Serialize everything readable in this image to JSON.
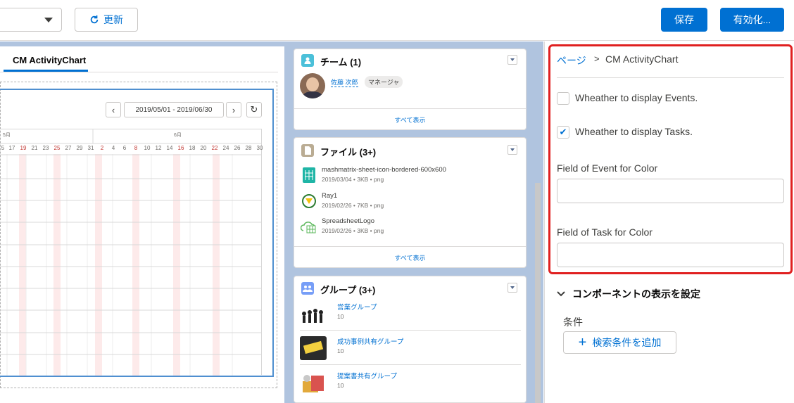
{
  "toolbar": {
    "refresh_label": "更新",
    "save_label": "保存",
    "activate_label": "有効化..."
  },
  "tabs": [
    {
      "label": "CM ActivityChart"
    }
  ],
  "activity_chart": {
    "date_range": "2019/05/01 - 2019/06/30",
    "prev_label": "‹",
    "next_label": "›",
    "refresh_label": "↻",
    "months": [
      "5月",
      "6月"
    ],
    "days": [
      "5",
      "17",
      "19",
      "21",
      "23",
      "25",
      "27",
      "29",
      "31",
      "2",
      "4",
      "6",
      "8",
      "10",
      "12",
      "14",
      "16",
      "18",
      "20",
      "22",
      "24",
      "26",
      "28",
      "30"
    ],
    "weekend_days": [
      "19",
      "25",
      "2",
      "8",
      "16",
      "22"
    ]
  },
  "team_card": {
    "title": "チーム (1)",
    "member_name": "佐藤 次郎",
    "member_role": "マネージャ",
    "view_all": "すべて表示"
  },
  "files_card": {
    "title": "ファイル (3+)",
    "files": [
      {
        "name": "mashmatrix-sheet-icon-bordered-600x600",
        "meta": "2019/03/04 • 3KB • png"
      },
      {
        "name": "Ray1",
        "meta": "2019/02/26 • 7KB • png"
      },
      {
        "name": "SpreadsheetLogo",
        "meta": "2019/02/26 • 3KB • png"
      }
    ],
    "view_all": "すべて表示"
  },
  "groups_card": {
    "title": "グループ (3+)",
    "groups": [
      {
        "name": "営業グループ",
        "count": "10"
      },
      {
        "name": "成功事例共有グループ",
        "count": "10"
      },
      {
        "name": "提案書共有グループ",
        "count": "10"
      }
    ]
  },
  "properties": {
    "breadcrumb_root": "ページ",
    "breadcrumb_sep": ">",
    "breadcrumb_current": "CM ActivityChart",
    "display_events_label": "Wheather to display Events.",
    "display_events_checked": false,
    "display_tasks_label": "Wheather to display Tasks.",
    "display_tasks_checked": true,
    "event_color_label": "Field of Event for Color",
    "event_color_value": "",
    "task_color_label": "Field of Task for Color",
    "task_color_value": ""
  },
  "visibility": {
    "header": "コンポーネントの表示を設定",
    "conditions_label": "条件",
    "add_filter_label": "検索条件を追加"
  },
  "colors": {
    "brand": "#0070d2",
    "highlight": "#e02020",
    "canvas_bg": "#b0c4df"
  }
}
